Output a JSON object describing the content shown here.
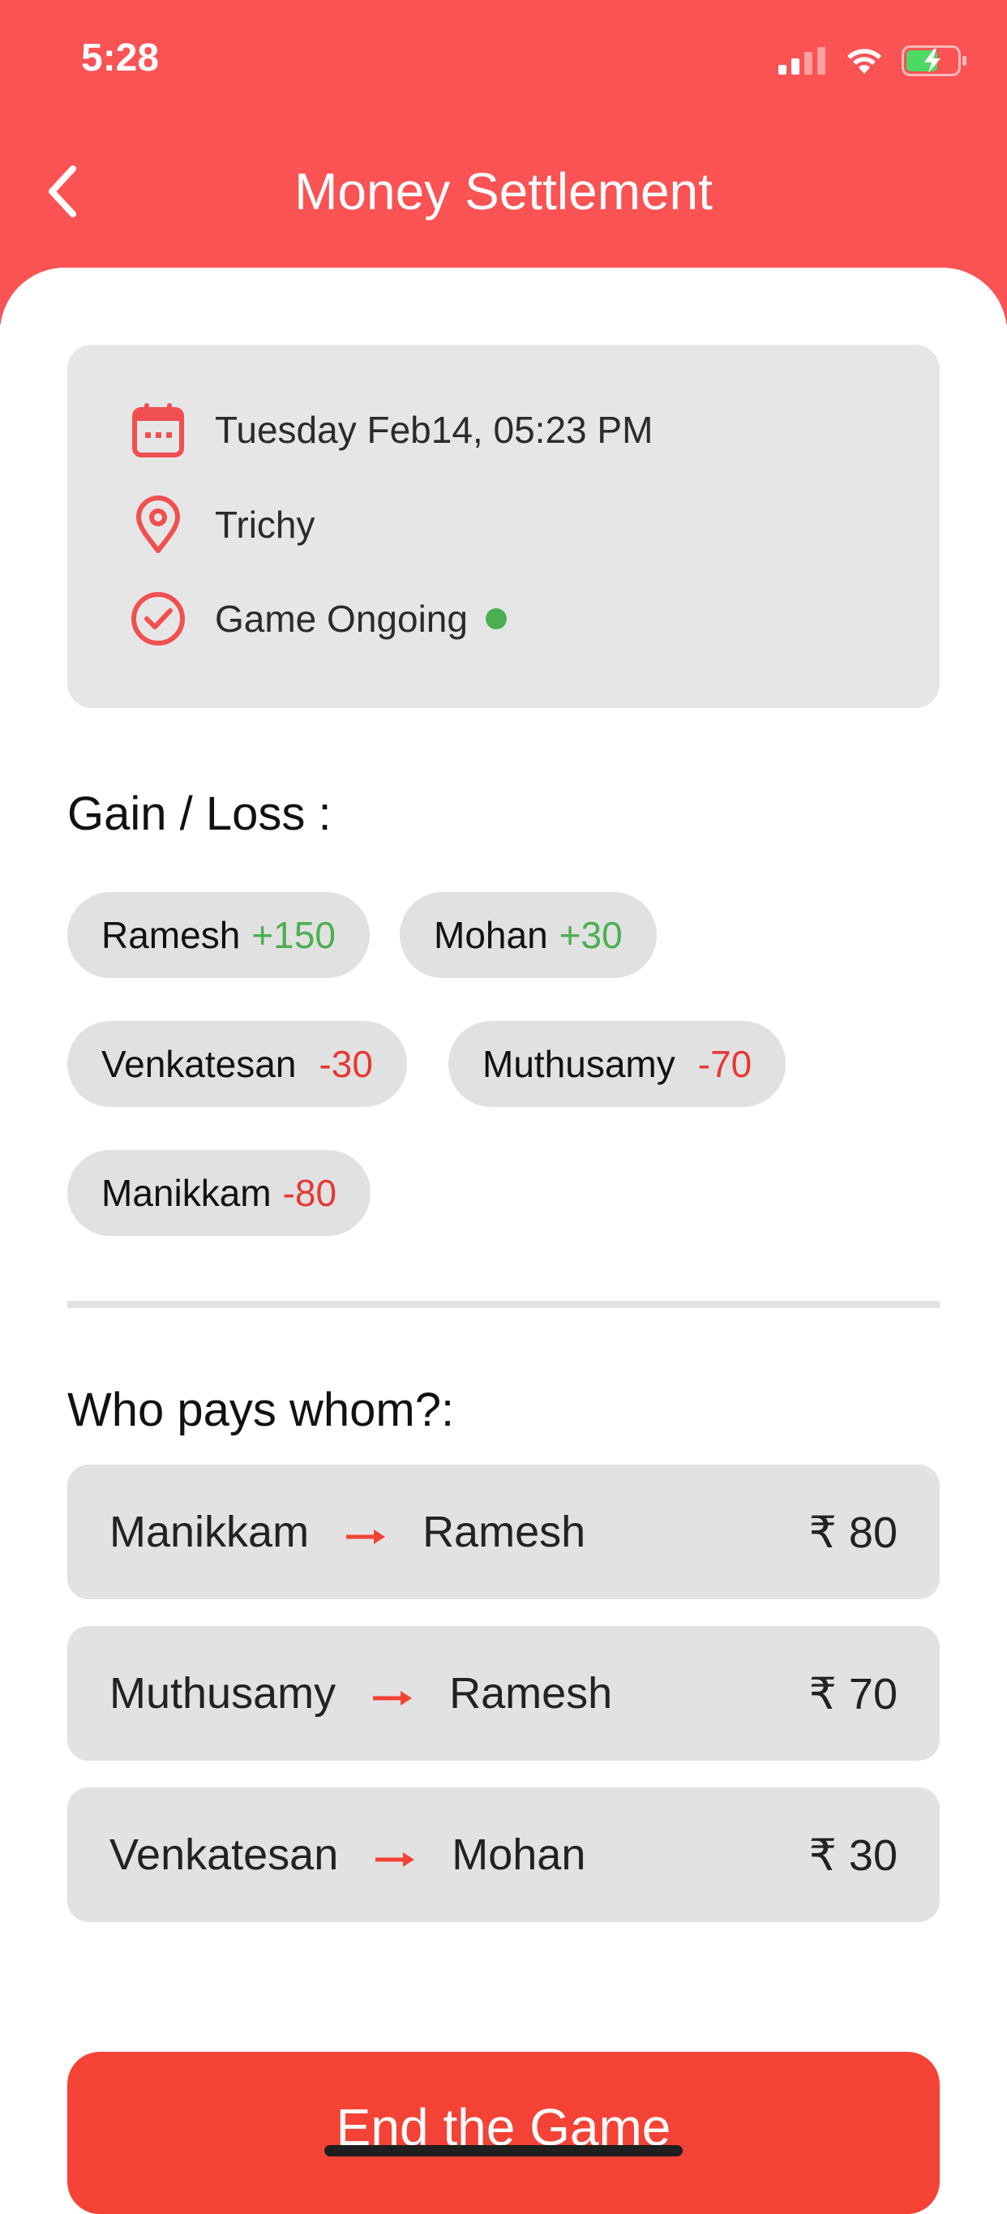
{
  "status_bar": {
    "time": "5:28"
  },
  "header": {
    "title": "Money Settlement",
    "background": "#fb5254"
  },
  "info": {
    "datetime": "Tuesday Feb14, 05:23 PM",
    "location": "Trichy",
    "status": "Game Ongoing",
    "status_color": "#4caf50"
  },
  "gain_loss": {
    "title": "Gain / Loss :",
    "players": [
      {
        "name": "Ramesh",
        "amount": "+150",
        "color": "#4caf50"
      },
      {
        "name": "Mohan",
        "amount": "+30",
        "color": "#4caf50"
      },
      {
        "name": "Venkatesan",
        "amount": "-30",
        "color": "#e53935"
      },
      {
        "name": "Muthusamy",
        "amount": "-70",
        "color": "#e53935"
      },
      {
        "name": "Manikkam",
        "amount": "-80",
        "color": "#e53935"
      }
    ]
  },
  "payments": {
    "title": "Who pays whom?:",
    "rows": [
      {
        "from": "Manikkam",
        "to": "Ramesh",
        "amount": "₹ 80"
      },
      {
        "from": "Muthusamy",
        "to": "Ramesh",
        "amount": "₹ 70"
      },
      {
        "from": "Venkatesan",
        "to": "Mohan",
        "amount": "₹ 30"
      }
    ],
    "arrow": "→"
  },
  "end_button": {
    "label": "End the Game",
    "color": "#f44336"
  }
}
